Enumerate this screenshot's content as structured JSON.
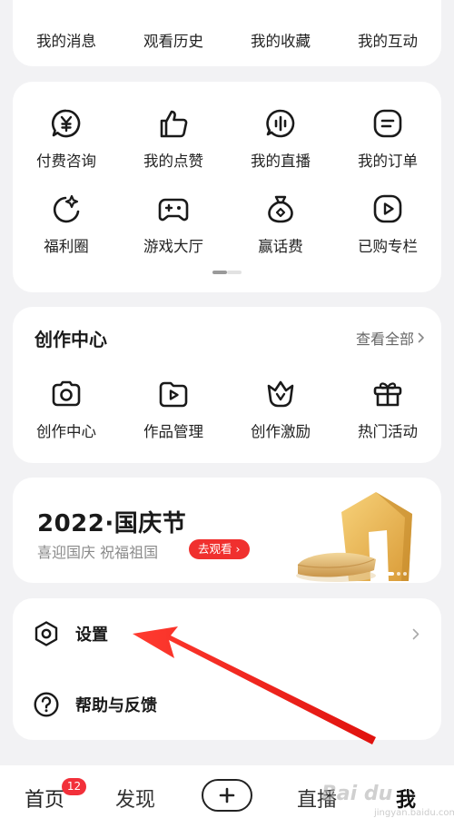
{
  "top_row": [
    {
      "label": "我的消息",
      "icon": "message-icon"
    },
    {
      "label": "观看历史",
      "icon": "history-icon"
    },
    {
      "label": "我的收藏",
      "icon": "favorites-icon"
    },
    {
      "label": "我的互动",
      "icon": "interaction-icon"
    }
  ],
  "services": {
    "row1": [
      {
        "label": "付费咨询",
        "icon": "yuan-chat-icon"
      },
      {
        "label": "我的点赞",
        "icon": "thumbs-up-icon"
      },
      {
        "label": "我的直播",
        "icon": "live-voice-icon"
      },
      {
        "label": "我的订单",
        "icon": "order-icon"
      }
    ],
    "row2": [
      {
        "label": "福利圈",
        "icon": "moon-star-icon"
      },
      {
        "label": "游戏大厅",
        "icon": "gamepad-icon"
      },
      {
        "label": "赢话费",
        "icon": "money-bag-icon"
      },
      {
        "label": "已购专栏",
        "icon": "purchased-column-icon"
      }
    ]
  },
  "creator": {
    "title": "创作中心",
    "view_all": "查看全部",
    "items": [
      {
        "label": "创作中心",
        "icon": "camera-icon"
      },
      {
        "label": "作品管理",
        "icon": "works-folder-icon"
      },
      {
        "label": "创作激励",
        "icon": "crown-icon"
      },
      {
        "label": "热门活动",
        "icon": "gift-icon"
      }
    ]
  },
  "banner": {
    "title": "2022·国庆节",
    "subtitle": "喜迎国庆 祝福祖国",
    "button": "去观看",
    "accent": "#f0302e"
  },
  "settings": {
    "settings_label": "设置",
    "help_label": "帮助与反馈"
  },
  "bottom_nav": {
    "home": "首页",
    "home_badge": "12",
    "discover": "发现",
    "live": "直播",
    "me": "我"
  },
  "watermark": {
    "text": "Bai du",
    "sub": "jingyan.baidu.com"
  },
  "colors": {
    "accent_red": "#e8334a",
    "background": "#f2f2f4",
    "annotation_arrow": "#ee1c1c"
  }
}
